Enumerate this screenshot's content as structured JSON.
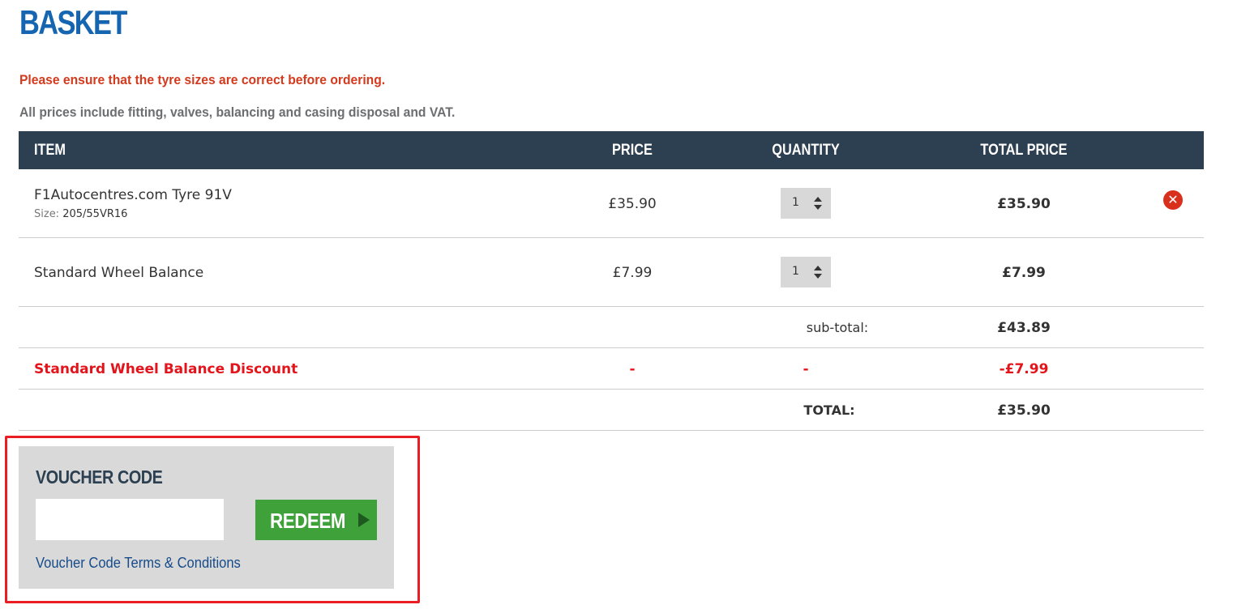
{
  "page": {
    "title": "BASKET",
    "notice": "Please ensure that the tyre sizes are correct before ordering.",
    "info": "All prices include fitting, valves, balancing and casing disposal and VAT."
  },
  "table": {
    "headers": {
      "item": "ITEM",
      "price": "PRICE",
      "quantity": "QUANTITY",
      "total": "TOTAL PRICE"
    },
    "rows": [
      {
        "name": "F1Autocentres.com Tyre 91V",
        "size_label": "Size:",
        "size_value": "205/55VR16",
        "price": "£35.90",
        "quantity": "1",
        "total": "£35.90",
        "remove_icon": "remove-circle-icon"
      },
      {
        "name": "Standard Wheel Balance",
        "price": "£7.99",
        "quantity": "1",
        "total": "£7.99"
      }
    ],
    "subtotal": {
      "label": "sub-total:",
      "value": "£43.89"
    },
    "discount": {
      "name": "Standard Wheel Balance Discount",
      "price": "-",
      "quantity": "-",
      "total": "-£7.99"
    },
    "total": {
      "label": "TOTAL:",
      "value": "£35.90"
    }
  },
  "voucher": {
    "title": "VOUCHER CODE",
    "input_value": "",
    "input_placeholder": "",
    "redeem_label": "REDEEM",
    "terms_link": "Voucher Code Terms & Conditions"
  },
  "colors": {
    "title_blue": "#1565b0",
    "notice_red": "#d43a1e",
    "header_bg": "#2d4051",
    "discount_red": "#e3141b",
    "redeem_green": "#3fa13a",
    "highlight_red": "#ea1c24"
  }
}
